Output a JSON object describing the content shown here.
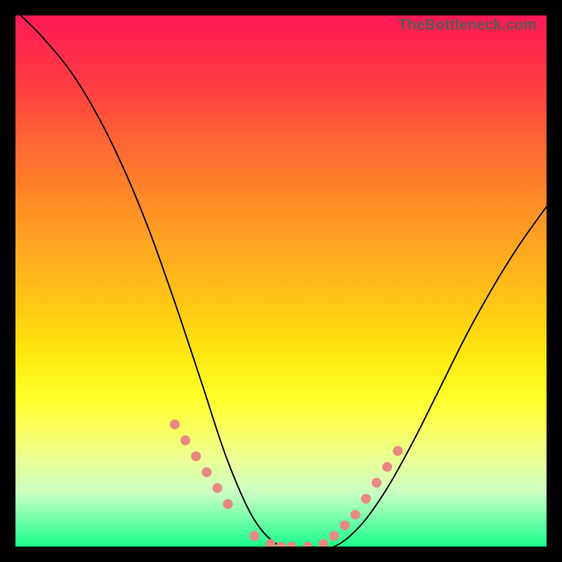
{
  "watermark": "TheBottleneck.com",
  "chart_data": {
    "type": "line",
    "title": "",
    "xlabel": "",
    "ylabel": "",
    "xlim": [
      0,
      100
    ],
    "ylim": [
      0,
      100
    ],
    "series": [
      {
        "name": "curve",
        "x": [
          1,
          5,
          10,
          15,
          20,
          25,
          30,
          35,
          40,
          45,
          50,
          55,
          60,
          65,
          70,
          75,
          80,
          85,
          90,
          95,
          100
        ],
        "y": [
          100,
          96,
          90,
          82,
          72,
          60,
          46,
          31,
          16,
          5,
          0,
          0,
          0,
          4,
          11,
          20,
          30,
          40,
          49,
          57,
          64
        ]
      }
    ],
    "markers": {
      "name": "highlight-dots",
      "x": [
        30,
        32,
        34,
        36,
        38,
        40,
        45,
        48,
        50,
        52,
        55,
        58,
        60,
        62,
        64,
        66,
        68,
        70,
        72
      ],
      "y": [
        23,
        20,
        17,
        14,
        11,
        8,
        2,
        0.5,
        0,
        0,
        0,
        0.5,
        2,
        4,
        6,
        9,
        12,
        15,
        18
      ]
    },
    "gradient_axis": "y",
    "gradient_meaning": "low y = green (good), high y = red (bad)"
  }
}
